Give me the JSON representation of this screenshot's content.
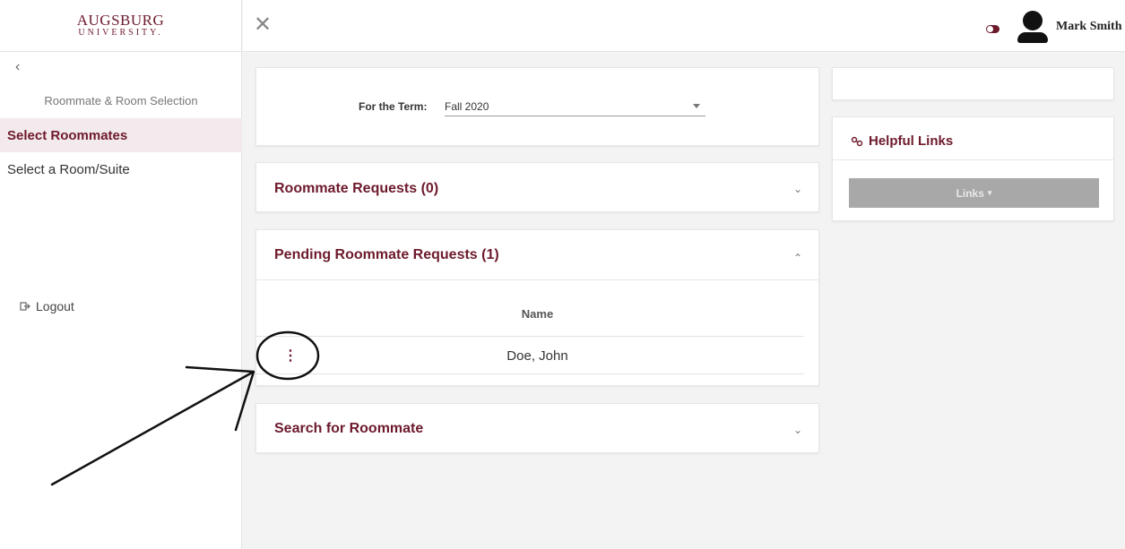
{
  "sidebar": {
    "logo_main": "AUGSBURG",
    "logo_sub": "UNIVERSITY.",
    "back_icon": "chevron-left-icon",
    "section_title": "Roommate & Room Selection",
    "items": [
      {
        "label": "Select Roommates",
        "active": true
      },
      {
        "label": "Select a Room/Suite",
        "active": false
      }
    ],
    "logout_label": "Logout"
  },
  "topbar": {
    "close_icon": "close-icon",
    "user_name": "Mark Smith"
  },
  "term": {
    "label": "For the Term:",
    "value": "Fall 2020"
  },
  "roommate_requests": {
    "title": "Roommate Requests (0)"
  },
  "pending_requests": {
    "title": "Pending Roommate Requests (1)",
    "column": "Name",
    "rows": [
      {
        "name": "Doe, John"
      }
    ]
  },
  "search": {
    "title": "Search for Roommate"
  },
  "helpful_links": {
    "title": "Helpful Links",
    "button_label": "Links"
  },
  "colors": {
    "brand": "#6d1a2b",
    "disabled_button": "#a8a8a8"
  }
}
